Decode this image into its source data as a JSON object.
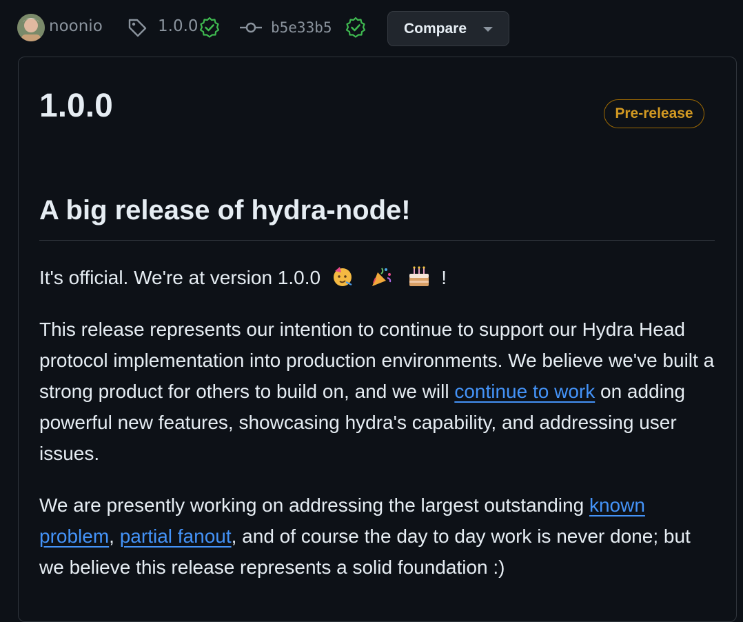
{
  "header": {
    "author": "noonio",
    "tag": "1.0.0",
    "commit": "b5e33b5",
    "compare_label": "Compare"
  },
  "release": {
    "title": "1.0.0",
    "badge": "Pre-release",
    "heading": "A big release of hydra-node!",
    "p1_text": "It's official. We're at version 1.0.0",
    "p1_end": "!",
    "p2_a": "This release represents our intention to continue to support our Hydra Head protocol implementation into production environments. We believe we've built a strong product for others to build on, and we will ",
    "p2_link": "continue to work",
    "p2_b": " on adding powerful new features, showcasing hydra's capability, and addressing user issues.",
    "p3_a": "We are presently working on addressing the largest outstanding ",
    "p3_link1": "known problem",
    "p3_sep": ", ",
    "p3_link2": "partial fanout",
    "p3_b": ", and of course the day to day work is never done; but we believe this release represents a solid foundation :)"
  },
  "icons": {
    "tag": "tag-icon",
    "commit": "git-commit-icon",
    "verified": "verified-check-icon",
    "emojis": [
      "partying-face-emoji",
      "party-popper-emoji",
      "birthday-cake-emoji"
    ]
  },
  "colors": {
    "background": "#0d1117",
    "link": "#4493f8",
    "badge": "#d29922",
    "verified": "#3fb950"
  }
}
